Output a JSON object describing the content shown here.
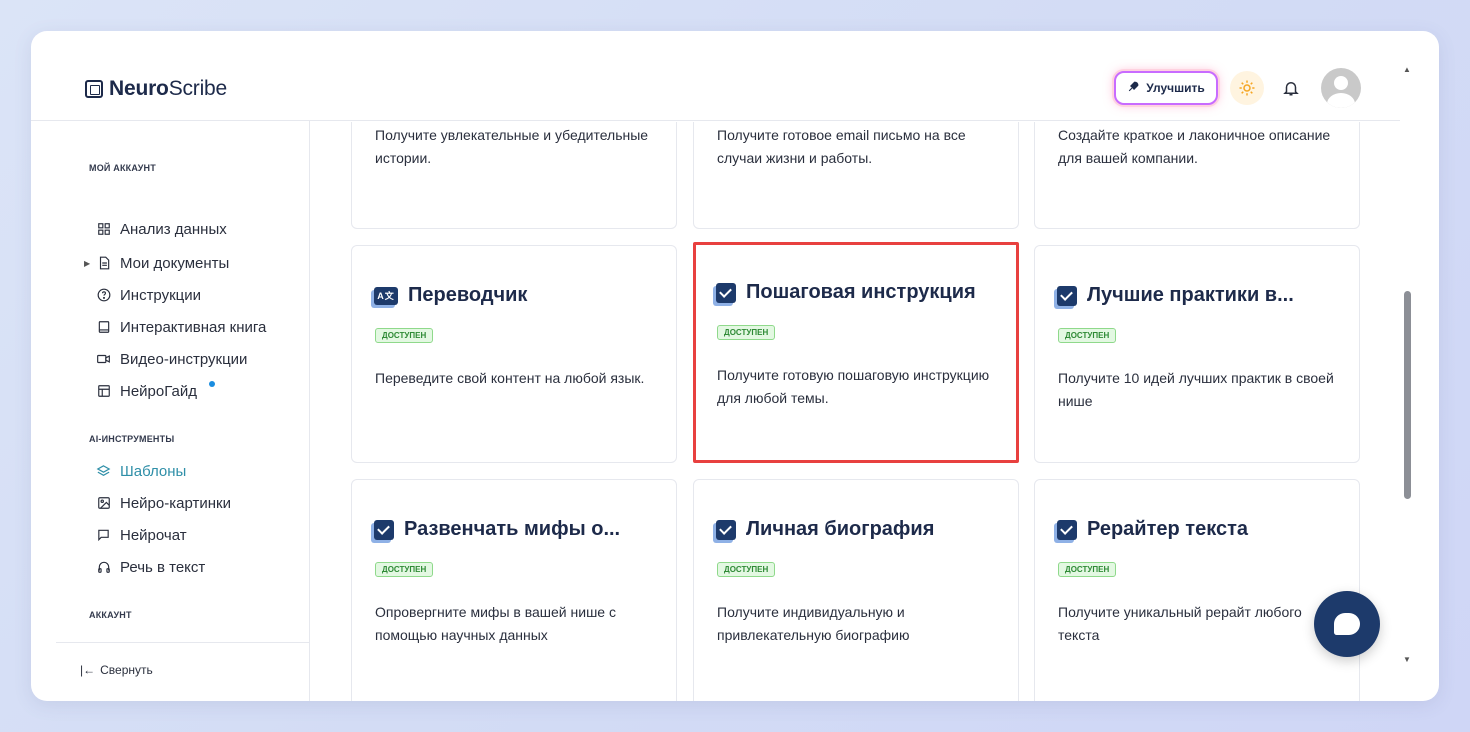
{
  "app": {
    "logo_bold": "Neuro",
    "logo_regular": "Scribe"
  },
  "header": {
    "upgrade_label": "Улучшить"
  },
  "sidebar": {
    "section_account": "МОЙ АККАУНТ",
    "items_account": [
      {
        "label": "Анализ данных",
        "icon": "grid-icon"
      },
      {
        "label": "Мои документы",
        "icon": "document-icon"
      },
      {
        "label": "Инструкции",
        "icon": "help-circle-icon"
      },
      {
        "label": "Интерактивная книга",
        "icon": "book-icon"
      },
      {
        "label": "Видео-инструкции",
        "icon": "video-icon"
      },
      {
        "label": "НейроГайд",
        "icon": "table-icon"
      }
    ],
    "section_ai": "AI-ИНСТРУМЕНТЫ",
    "items_ai": [
      {
        "label": "Шаблоны",
        "icon": "layers-icon",
        "active": true
      },
      {
        "label": "Нейро-картинки",
        "icon": "image-icon"
      },
      {
        "label": "Нейрочат",
        "icon": "chat-icon"
      },
      {
        "label": "Речь в текст",
        "icon": "headphones-icon"
      }
    ],
    "section_profile": "АККАУНТ",
    "collapse_label": "Свернуть"
  },
  "cards": [
    {
      "title": "",
      "status": "",
      "description": "Получите увлекательные и убедительные истории."
    },
    {
      "title": "",
      "status": "",
      "description": "Получите готовое email письмо на все случаи жизни и работы."
    },
    {
      "title": "",
      "status": "",
      "description": "Создайте краткое и лаконичное описание для вашей компании."
    },
    {
      "title": "Переводчик",
      "status": "ДОСТУПЕН",
      "description": "Переведите свой контент на любой язык."
    },
    {
      "title": "Пошаговая инструкция",
      "status": "ДОСТУПЕН",
      "description": "Получите готовую пошаговую инструкцию для любой темы."
    },
    {
      "title": "Лучшие практики в...",
      "status": "ДОСТУПЕН",
      "description": "Получите 10 идей лучших практик в своей нише"
    },
    {
      "title": "Развенчать мифы о...",
      "status": "ДОСТУПЕН",
      "description": "Опровергните мифы в вашей нише с помощью научных данных"
    },
    {
      "title": "Личная биография",
      "status": "ДОСТУПЕН",
      "description": "Получите индивидуальную и привлекательную биографию"
    },
    {
      "title": "Рерайтер текста",
      "status": "ДОСТУПЕН",
      "description": "Получите уникальный рерайт любого текста"
    }
  ],
  "colors": {
    "accent": "#2f8fa8",
    "brand_dark": "#1d3a6b",
    "highlight_border": "#e8403f",
    "badge_green": "#2e8a35"
  }
}
